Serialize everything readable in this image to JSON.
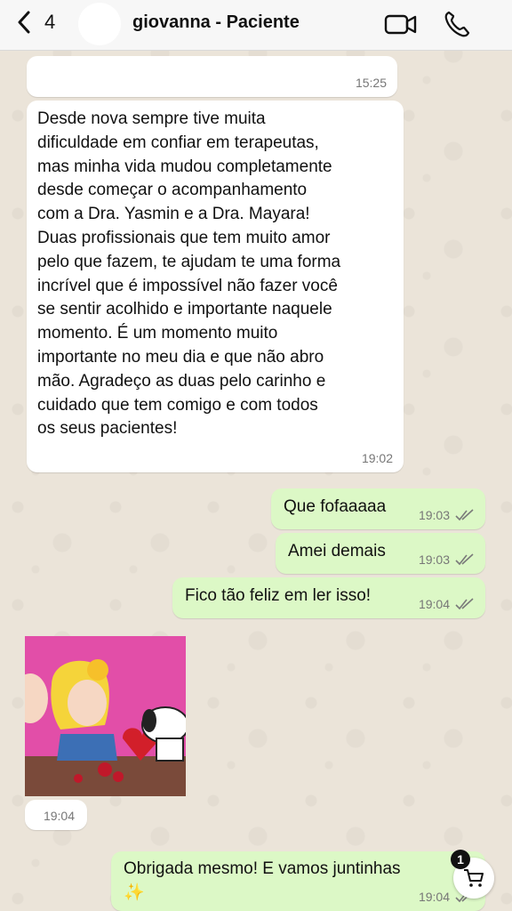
{
  "header": {
    "back_count": "4",
    "contact_name": "giovanna - Paciente"
  },
  "messages": [
    {
      "direction": "in",
      "text": "",
      "time": "15:25"
    },
    {
      "direction": "in",
      "text": "Desde nova sempre tive muita\ndificuldade em confiar em terapeutas,\nmas minha vida mudou completamente\ndesde começar o acompanhamento\ncom a Dra. Yasmin e a Dra. Mayara!\nDuas profissionais que tem muito amor\npelo que fazem, te ajudam te uma forma\nincrível que é impossível não fazer você\nse sentir acolhido e importante naquele\nmomento. É um momento muito\nimportante no meu dia e que não abro\nmão. Agradeço as duas pelo carinho e\ncuidado que tem comigo e com todos\nos seus pacientes!",
      "time": "19:02"
    },
    {
      "direction": "out",
      "text": "Que fofaaaaa",
      "time": "19:03",
      "status": "read"
    },
    {
      "direction": "out",
      "text": "Amei demais",
      "time": "19:03",
      "status": "read"
    },
    {
      "direction": "out",
      "text": "Fico tão feliz em ler isso!",
      "time": "19:04",
      "status": "read"
    },
    {
      "direction": "in",
      "type": "sticker",
      "text": "",
      "time": "19:04"
    },
    {
      "direction": "out",
      "text": "Obrigada mesmo! E vamos juntinhas\n✨",
      "time": "19:04",
      "status": "read"
    }
  ],
  "cart_badge": "1",
  "colors": {
    "incoming": "#ffffff",
    "outgoing": "#dcf8c6",
    "read_ticks": "#7a7a7a",
    "wallpaper": "#ebe4d9"
  },
  "icons": [
    "chevron-left-icon",
    "video-call-icon",
    "phone-icon",
    "double-check-icon",
    "shopping-cart-icon",
    "sparkles-icon"
  ]
}
